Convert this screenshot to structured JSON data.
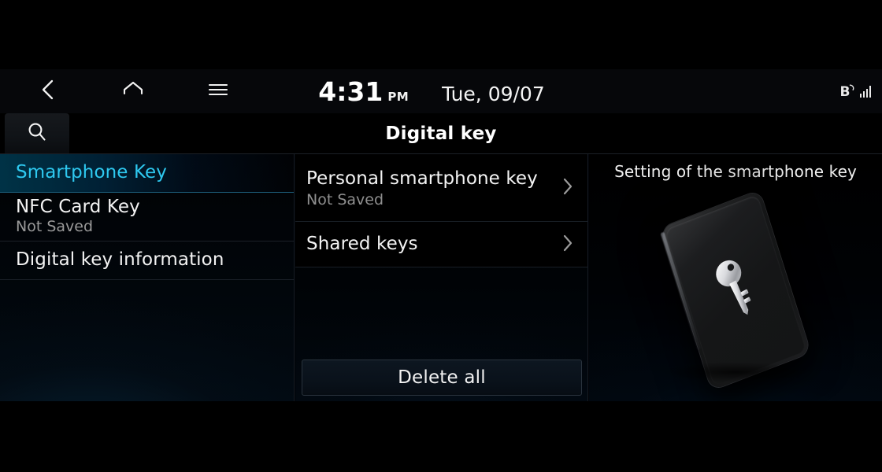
{
  "statusbar": {
    "back_icon": "chevron-left-icon",
    "home_icon": "home-icon",
    "menu_icon": "hamburger-menu-icon",
    "time": "4:31",
    "meridiem": "PM",
    "date": "Tue, 09/07",
    "bluetooth_label": "B",
    "signal_bars": 4
  },
  "titlebar": {
    "search_icon": "search-icon",
    "title": "Digital key"
  },
  "sidebar": {
    "items": [
      {
        "label": "Smartphone Key",
        "sub": "",
        "selected": true
      },
      {
        "label": "NFC Card Key",
        "sub": "Not Saved",
        "selected": false
      },
      {
        "label": "Digital key information",
        "sub": "",
        "selected": false
      }
    ]
  },
  "center": {
    "rows": [
      {
        "label": "Personal smartphone key",
        "sub": "Not Saved",
        "chevron": "chevron-right-icon"
      },
      {
        "label": "Shared keys",
        "sub": "",
        "chevron": "chevron-right-icon"
      }
    ],
    "delete_all_label": "Delete all"
  },
  "right": {
    "heading": "Setting of the smartphone key",
    "illustration": "smartphone-with-key-icon"
  },
  "colors": {
    "accent_cyan": "#2ec9f0",
    "text_primary": "#f4f4f4",
    "text_secondary": "#8f8f8f",
    "divider": "#1a2028",
    "background": "#000206"
  }
}
